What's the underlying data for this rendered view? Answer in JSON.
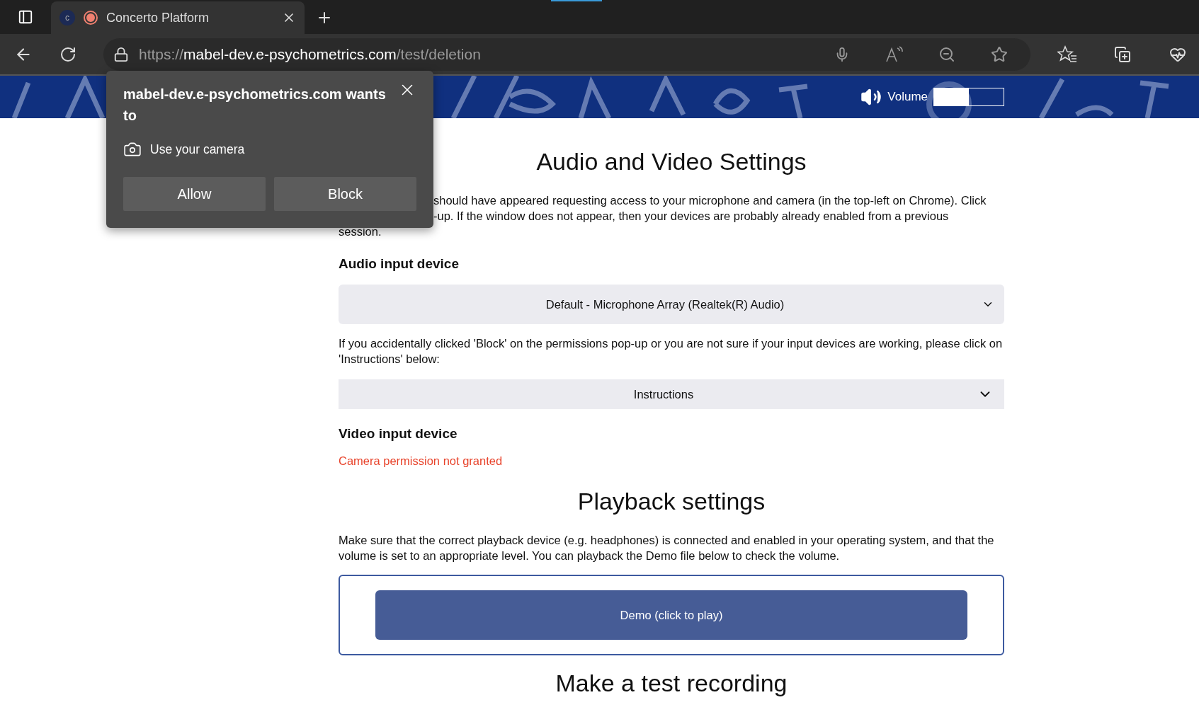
{
  "browser": {
    "tab_title": "Concerto Platform",
    "favicon_letter": "c",
    "url_scheme": "https://",
    "url_host": "mabel-dev.e-psychometrics.com",
    "url_path": "/test/deletion"
  },
  "banner": {
    "volume_label": "Volume",
    "volume": {
      "level": 0.5
    }
  },
  "permission_popup": {
    "title": "mabel-dev.e-psychometrics.com wants to",
    "request": "Use your camera",
    "buttons": [
      "Allow",
      "Block"
    ]
  },
  "content": {
    "heading": "Audio and Video Settings",
    "intro_lines": [
      {
        "text": "should have appeared requesting access to your microphone and camera (in the top-left on Chrome). Click",
        "partly_hidden": true
      },
      {
        "text": "-up. If the window does not appear, then your devices are probably already enabled from a previous",
        "partly_hidden": true
      },
      {
        "text": "session.",
        "partly_hidden": false
      }
    ],
    "audio_label": "Audio input device",
    "audio_select": {
      "value": "Default - Microphone Array (Realtek(R) Audio)"
    },
    "help_text": "If you accidentally clicked 'Block' on the permissions pop-up or you are not sure if your input devices are working, please click on 'Instructions' below:",
    "instructions": {
      "label": "Instructions",
      "expanded": false
    },
    "video_label": "Video input device",
    "video_error": "Camera permission not granted",
    "playback_heading": "Playback settings",
    "playback_text": "Make sure that the correct playback device (e.g. headphones) is connected and enabled in your operating system, and that the volume is set to an appropriate level. You can playback the Demo file below to check the volume.",
    "demo_button": "Demo (click to play)",
    "recording_heading": "Make a test recording"
  }
}
